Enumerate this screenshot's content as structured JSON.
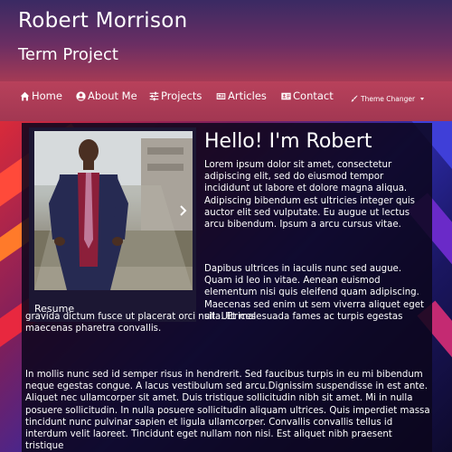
{
  "header": {
    "title": "Robert Morrison",
    "subtitle": "Term Project"
  },
  "nav": {
    "items": [
      {
        "label": "Home",
        "icon": "home-icon"
      },
      {
        "label": "About Me",
        "icon": "user-circle-icon"
      },
      {
        "label": "Projects",
        "icon": "sliders-icon"
      },
      {
        "label": "Articles",
        "icon": "newspaper-icon"
      },
      {
        "label": "Contact",
        "icon": "address-card-icon"
      }
    ],
    "theme_changer": "Theme Changer"
  },
  "carousel": {
    "caption": "Resume",
    "slide_count": 4,
    "active_index": 0
  },
  "main": {
    "heading": "Hello! I'm Robert",
    "p1": "Lorem ipsum dolor sit amet, consectetur adipiscing elit, sed do eiusmod tempor incididunt ut labore et dolore magna aliqua. Adipiscing bibendum est ultricies integer quis auctor elit sed vulputate. Eu augue ut lectus arcu bibendum. Ipsum a arcu cursus vitae.",
    "p2_part1": "Dapibus ultrices in iaculis nunc sed augue. Quam id leo in vitae. Aenean euismod elementum nisi quis eleifend quam adipiscing. Maecenas sed enim ut sem viverra aliquet eget sit. Ultrices",
    "p2_part2": "gravida dictum fusce ut placerat orci nulla. Et malesuada fames ac turpis egestas maecenas pharetra convallis.",
    "p3": "In mollis nunc sed id semper risus in hendrerit. Sed faucibus turpis in eu mi bibendum neque egestas congue. A lacus vestibulum sed arcu.Dignissim suspendisse in est ante. Aliquet nec ullamcorper sit amet. Duis tristique sollicitudin nibh sit amet. Mi in nulla posuere sollicitudin. In nulla posuere sollicitudin aliquam ultrices. Quis imperdiet massa tincidunt nunc pulvinar sapien et ligula ullamcorper. Convallis convallis tellus id interdum velit laoreet. Tincidunt eget nullam non nisi. Est aliquet nibh praesent tristique"
  },
  "colors": {
    "header_top": "#3a2a63",
    "header_bottom": "#a43a55",
    "nav": "#b8415b",
    "panel": "#0c061c"
  }
}
